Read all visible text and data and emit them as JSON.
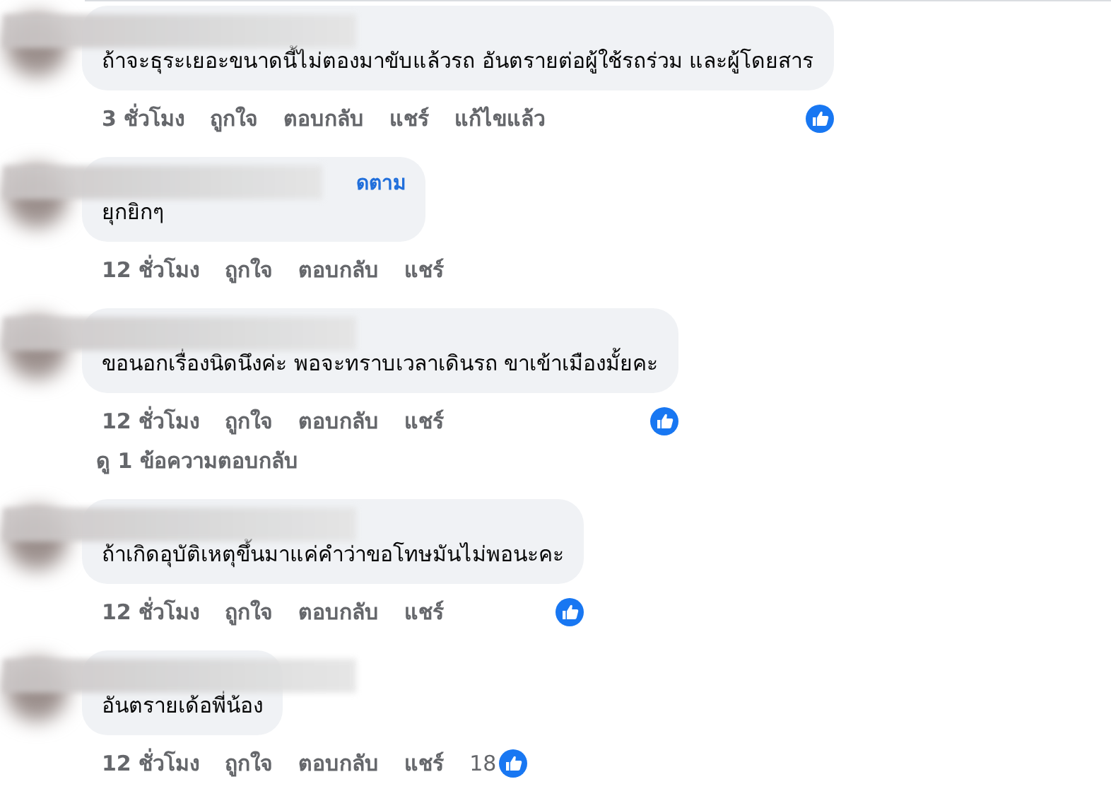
{
  "comments": [
    {
      "text": "ถ้าจะธุระเยอะขนาดนี้ไม่ตองมาขับแล้วรถ อันตรายต่อผู้ใช้รถร่วม และผู้โดยสาร",
      "time": "3 ชั่วโมง",
      "actions": [
        "ถูกใจ",
        "ตอบกลับ",
        "แชร์",
        "แก้ไขแล้ว"
      ],
      "liked": true
    },
    {
      "text": "ยุกยิกๆ",
      "follow": "ดตาม",
      "time": "12 ชั่วโมง",
      "actions": [
        "ถูกใจ",
        "ตอบกลับ",
        "แชร์"
      ],
      "liked": false
    },
    {
      "text": "ขอนอกเรื่องนิดนึงค่ะ พอจะทราบเวลาเดินรถ ขาเข้าเมืองมั้ยคะ",
      "time": "12 ชั่วโมง",
      "actions": [
        "ถูกใจ",
        "ตอบกลับ",
        "แชร์"
      ],
      "liked": true,
      "replies_link": "ดู 1 ข้อความตอบกลับ"
    },
    {
      "text": "ถ้าเกิดอุบัติเหตุขึ้นมาแค่คำว่าขอโทษมันไม่พอนะคะ",
      "time": "12 ชั่วโมง",
      "actions": [
        "ถูกใจ",
        "ตอบกลับ",
        "แชร์"
      ],
      "liked": true
    },
    {
      "text": "อันตรายเด้อพี่น้อง",
      "time": "12 ชั่วโมง",
      "actions": [
        "ถูกใจ",
        "ตอบกลับ",
        "แชร์"
      ],
      "liked": true,
      "like_count": "18"
    }
  ]
}
